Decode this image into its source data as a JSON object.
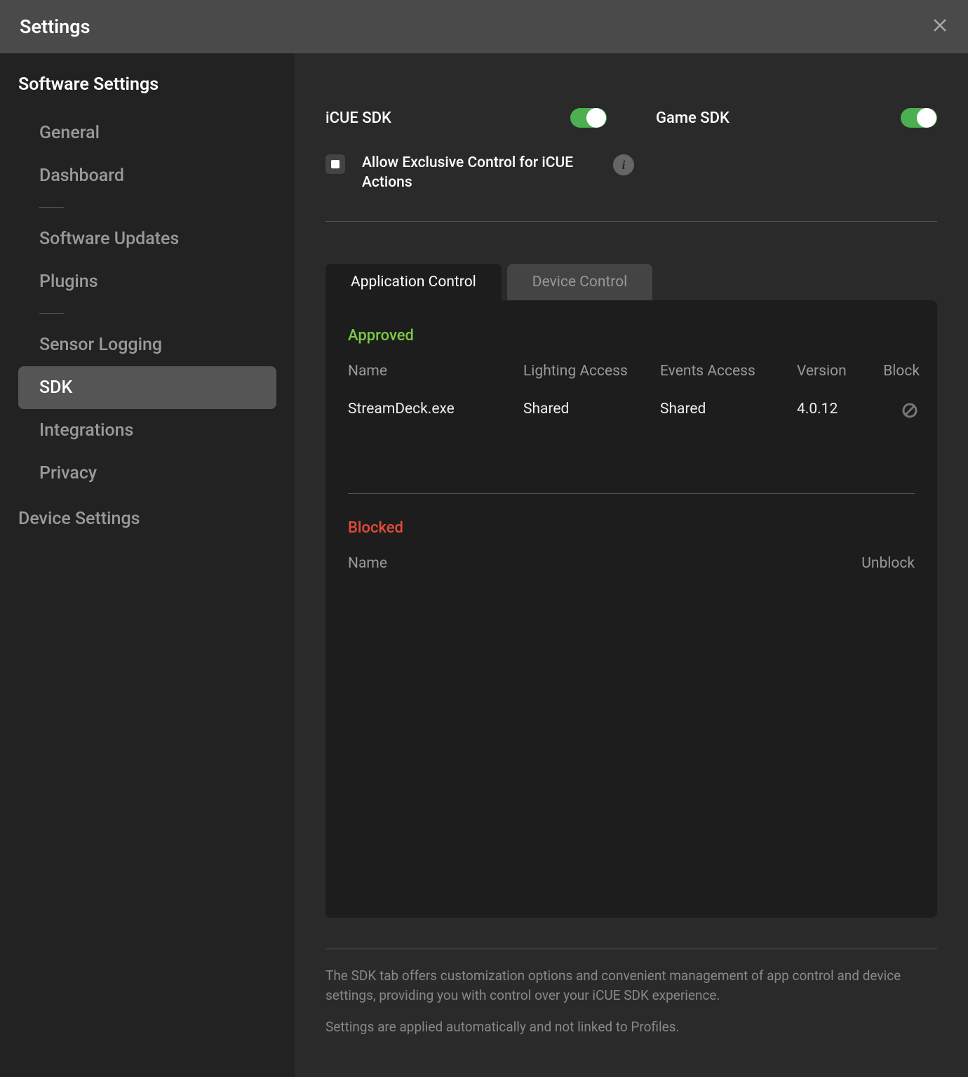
{
  "window": {
    "title": "Settings"
  },
  "sidebar": {
    "section1_title": "Software Settings",
    "items": [
      "General",
      "Dashboard",
      "Software Updates",
      "Plugins",
      "Sensor Logging",
      "SDK",
      "Integrations",
      "Privacy"
    ],
    "section2_title": "Device Settings"
  },
  "main": {
    "toggle1_label": "iCUE SDK",
    "toggle2_label": "Game SDK",
    "checkbox_label": "Allow Exclusive Control for iCUE Actions",
    "tabs": {
      "app": "Application Control",
      "device": "Device Control"
    },
    "approved": {
      "title": "Approved",
      "head": {
        "name": "Name",
        "light": "Lighting Access",
        "events": "Events Access",
        "version": "Version",
        "block": "Block"
      },
      "rows": [
        {
          "name": "StreamDeck.exe",
          "light": "Shared",
          "events": "Shared",
          "version": "4.0.12"
        }
      ]
    },
    "blocked": {
      "title": "Blocked",
      "head": {
        "name": "Name",
        "unblock": "Unblock"
      }
    },
    "footer1": "The SDK tab offers customization options and convenient management of app control and device settings, providing you with control over your iCUE SDK experience.",
    "footer2": "Settings are applied automatically and not linked to Profiles."
  }
}
